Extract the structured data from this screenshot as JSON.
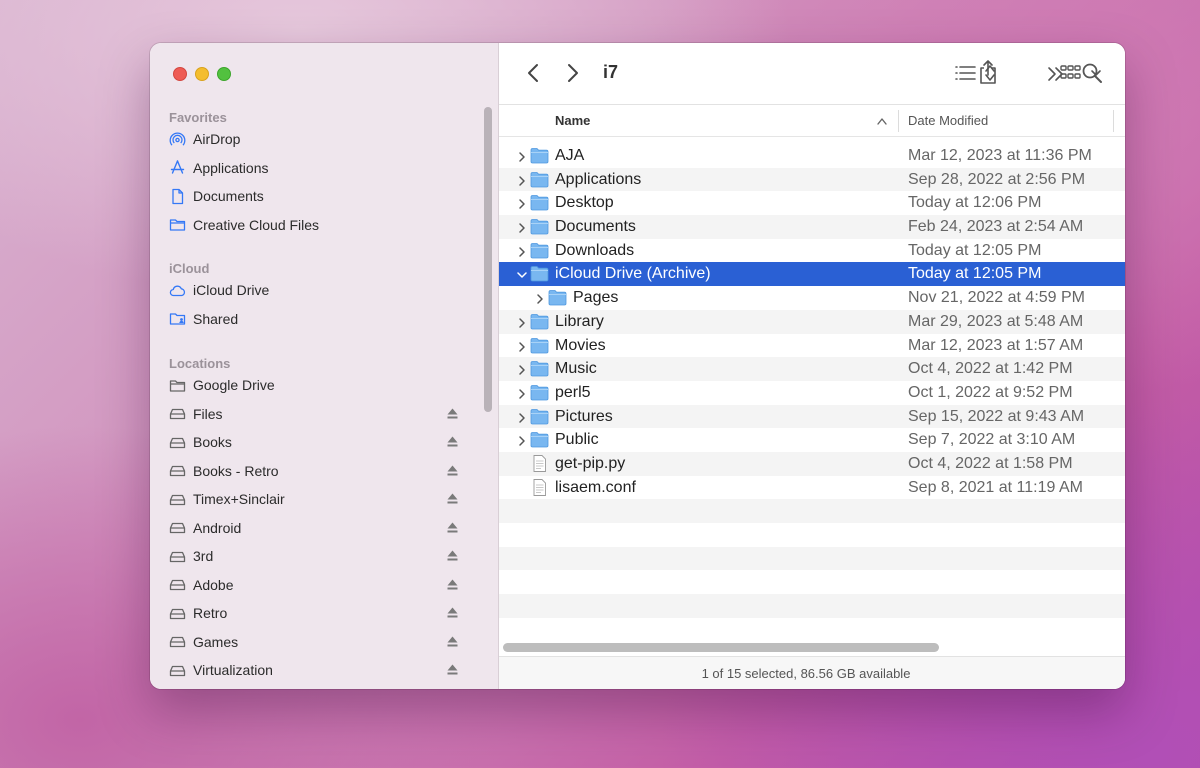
{
  "window": {
    "title": "i7",
    "colors": {
      "accent": "#2a60d4",
      "sidebar_icon": "#3478f6"
    }
  },
  "sidebar": {
    "sections": [
      {
        "title": "Favorites",
        "items": [
          {
            "label": "AirDrop",
            "icon": "airdrop-icon"
          },
          {
            "label": "Applications",
            "icon": "applications-icon"
          },
          {
            "label": "Documents",
            "icon": "document-icon"
          },
          {
            "label": "Creative Cloud Files",
            "icon": "folder-icon"
          }
        ]
      },
      {
        "title": "iCloud",
        "items": [
          {
            "label": "iCloud Drive",
            "icon": "cloud-icon"
          },
          {
            "label": "Shared",
            "icon": "shared-folder-icon"
          }
        ]
      },
      {
        "title": "Locations",
        "items": [
          {
            "label": "Google Drive",
            "icon": "folder-icon",
            "eject": false
          },
          {
            "label": "Files",
            "icon": "drive-icon",
            "eject": true
          },
          {
            "label": "Books",
            "icon": "drive-icon",
            "eject": true
          },
          {
            "label": "Books - Retro",
            "icon": "drive-icon",
            "eject": true
          },
          {
            "label": "Timex+Sinclair",
            "icon": "drive-icon",
            "eject": true
          },
          {
            "label": "Android",
            "icon": "drive-icon",
            "eject": true
          },
          {
            "label": "3rd",
            "icon": "drive-icon",
            "eject": true
          },
          {
            "label": "Adobe",
            "icon": "drive-icon",
            "eject": true
          },
          {
            "label": "Retro",
            "icon": "drive-icon",
            "eject": true
          },
          {
            "label": "Games",
            "icon": "drive-icon",
            "eject": true
          },
          {
            "label": "Virtualization",
            "icon": "drive-icon",
            "eject": true
          }
        ]
      }
    ]
  },
  "columns": {
    "name": "Name",
    "date": "Date Modified"
  },
  "files": [
    {
      "name": "AJA",
      "date": "Mar 12, 2023 at 11:36 PM",
      "type": "folder",
      "expanded": false,
      "selected": false,
      "level": 0
    },
    {
      "name": "Applications",
      "date": "Sep 28, 2022 at 2:56 PM",
      "type": "folder",
      "expanded": false,
      "selected": false,
      "level": 0
    },
    {
      "name": "Desktop",
      "date": "Today at 12:06 PM",
      "type": "folder",
      "expanded": false,
      "selected": false,
      "level": 0
    },
    {
      "name": "Documents",
      "date": "Feb 24, 2023 at 2:54 AM",
      "type": "folder",
      "expanded": false,
      "selected": false,
      "level": 0
    },
    {
      "name": "Downloads",
      "date": "Today at 12:05 PM",
      "type": "folder",
      "expanded": false,
      "selected": false,
      "level": 0
    },
    {
      "name": "iCloud Drive (Archive)",
      "date": "Today at 12:05 PM",
      "type": "folder",
      "expanded": true,
      "selected": true,
      "level": 0
    },
    {
      "name": "Pages",
      "date": "Nov 21, 2022 at 4:59 PM",
      "type": "folder",
      "expanded": false,
      "selected": false,
      "level": 1
    },
    {
      "name": "Library",
      "date": "Mar 29, 2023 at 5:48 AM",
      "type": "folder",
      "expanded": false,
      "selected": false,
      "level": 0
    },
    {
      "name": "Movies",
      "date": "Mar 12, 2023 at 1:57 AM",
      "type": "folder",
      "expanded": false,
      "selected": false,
      "level": 0
    },
    {
      "name": "Music",
      "date": "Oct 4, 2022 at 1:42 PM",
      "type": "folder",
      "expanded": false,
      "selected": false,
      "level": 0
    },
    {
      "name": "perl5",
      "date": "Oct 1, 2022 at 9:52 PM",
      "type": "folder",
      "expanded": false,
      "selected": false,
      "level": 0
    },
    {
      "name": "Pictures",
      "date": "Sep 15, 2022 at 9:43 AM",
      "type": "folder",
      "expanded": false,
      "selected": false,
      "level": 0
    },
    {
      "name": "Public",
      "date": "Sep 7, 2022 at 3:10 AM",
      "type": "folder",
      "expanded": false,
      "selected": false,
      "level": 0
    },
    {
      "name": "get-pip.py",
      "date": "Oct 4, 2022 at 1:58 PM",
      "type": "file",
      "expanded": false,
      "selected": false,
      "level": 0
    },
    {
      "name": "lisaem.conf",
      "date": "Sep 8, 2021 at 11:19 AM",
      "type": "file",
      "expanded": false,
      "selected": false,
      "level": 0
    }
  ],
  "status": {
    "text": "1 of 15 selected, 86.56 GB available"
  }
}
